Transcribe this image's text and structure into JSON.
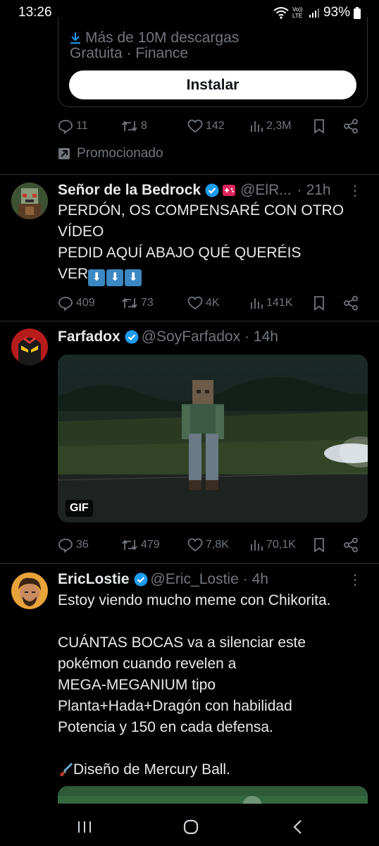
{
  "status_bar": {
    "time": "13:26",
    "network_label": "Vo)) LTE",
    "battery": "93%"
  },
  "ad": {
    "downloads": "Más de 10M descargas",
    "meta": "Gratuita · Finance",
    "install_label": "Instalar",
    "stats": {
      "replies": "11",
      "reposts": "8",
      "likes": "142",
      "views": "2,3M"
    },
    "promoted_label": "Promocionado"
  },
  "tweets": [
    {
      "name": "Señor de la Bedrock",
      "handle": "@ElR...",
      "time": "· 21h",
      "lines": [
        "PERDÓN, OS COMPENSARÉ CON OTRO",
        "VÍDEO",
        "PEDID AQUÍ ABAJO QUÉ QUERÉIS",
        "VER"
      ],
      "stats": {
        "replies": "409",
        "reposts": "73",
        "likes": "4K",
        "views": "141K"
      }
    },
    {
      "name": "Farfadox",
      "handle": "@SoyFarfadox",
      "time": "· 14h",
      "media_badge": "GIF",
      "stats": {
        "replies": "36",
        "reposts": "479",
        "likes": "7,8K",
        "views": "70,1K"
      }
    },
    {
      "name": "EricLostie",
      "handle": "@Eric_Lostie",
      "time": "· 4h",
      "lines": [
        "Estoy viendo mucho meme con Chikorita.",
        "",
        "CUÁNTAS BOCAS va a silenciar este",
        "pokémon cuando revelen a",
        "MEGA-MEGANIUM tipo",
        "Planta+Hada+Dragón con habilidad",
        "Potencia y 150 en cada defensa.",
        "",
        "Diseño de Mercury Ball."
      ]
    }
  ],
  "colors": {
    "background": "#000000",
    "text": "#e7e9ea",
    "muted": "#71767b",
    "verified": "#1d9bf0",
    "divider": "#2f3336"
  },
  "icons": [
    "reply-icon",
    "repost-icon",
    "like-icon",
    "views-icon",
    "bookmark-icon",
    "share-icon",
    "verified-icon",
    "more-icon",
    "promoted-icon",
    "download-icon",
    "gamepad-icon",
    "paintbrush-icon"
  ]
}
